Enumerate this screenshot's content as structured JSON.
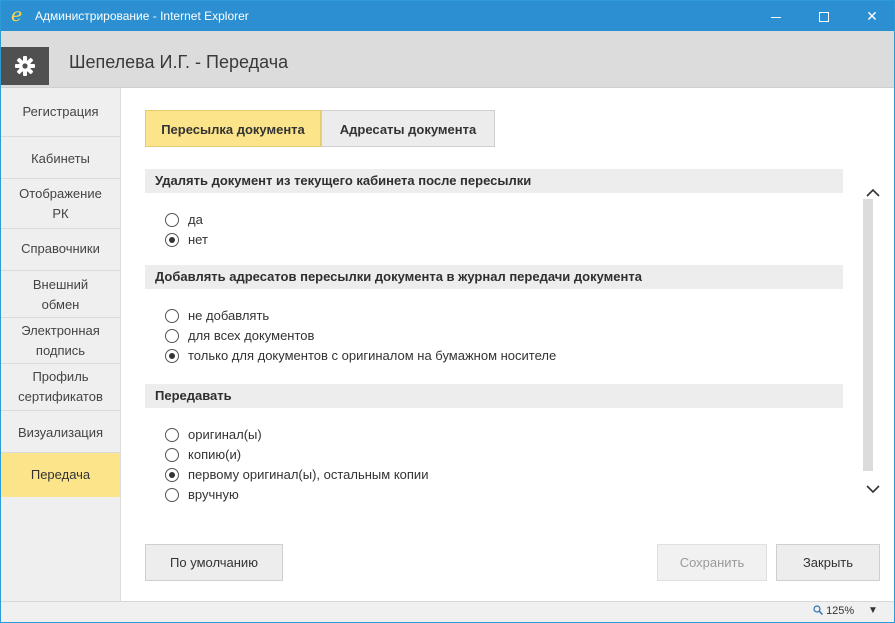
{
  "window": {
    "title": "Администрирование - Internet Explorer",
    "logo_glyph": "e",
    "minimize_icon": "minimize-icon",
    "maximize_icon": "maximize-icon",
    "close_glyph": "✕"
  },
  "header": {
    "icon": "gear-icon",
    "title": "Шепелева И.Г. - Передача"
  },
  "sidebar": {
    "items": [
      {
        "label": "Регистрация",
        "active": false
      },
      {
        "label": "Кабинеты",
        "active": false
      },
      {
        "label": "Отображение РК",
        "line1": "Отображение",
        "line2": "РК",
        "active": false
      },
      {
        "label": "Справочники",
        "active": false
      },
      {
        "label": "Внешний обмен",
        "line1": "Внешний",
        "line2": "обмен",
        "active": false
      },
      {
        "label": "Электронная подпись",
        "line1": "Электронная",
        "line2": "подпись",
        "active": false
      },
      {
        "label": "Профиль сертификатов",
        "line1": "Профиль",
        "line2": "сертификатов",
        "active": false
      },
      {
        "label": "Визуализация",
        "active": false
      },
      {
        "label": "Передача",
        "active": true
      }
    ],
    "active_color": "#fbe48a"
  },
  "tabs": [
    {
      "label": "Пересылка документа",
      "active": true
    },
    {
      "label": "Адресаты документа",
      "active": false
    }
  ],
  "sections": [
    {
      "title": "Удалять документ из текущего кабинета после пересылки",
      "options": [
        {
          "label": "да",
          "checked": false
        },
        {
          "label": "нет",
          "checked": true
        }
      ]
    },
    {
      "title": "Добавлять адресатов пересылки документа в журнал передачи документа",
      "options": [
        {
          "label": "не добавлять",
          "checked": false
        },
        {
          "label": "для всех документов",
          "checked": false
        },
        {
          "label": "только для документов с оригиналом на бумажном носителе",
          "checked": true
        }
      ]
    },
    {
      "title": "Передавать",
      "options": [
        {
          "label": "оригинал(ы)",
          "checked": false
        },
        {
          "label": "копию(и)",
          "checked": false
        },
        {
          "label": "первому оригинал(ы), остальным копии",
          "checked": true
        },
        {
          "label": "вручную",
          "checked": false
        }
      ]
    }
  ],
  "scrollbar": {
    "up_glyph": "^",
    "down_glyph": "v"
  },
  "buttons": {
    "default_label": "По умолчанию",
    "save_label": "Сохранить",
    "save_disabled": true,
    "close_label": "Закрыть"
  },
  "statusbar": {
    "zoom": "125%",
    "zoom_icon": "zoom-icon",
    "dropdown_glyph": "▼"
  },
  "colors": {
    "titlebar": "#2b8fd1",
    "accent": "#fbe48a"
  }
}
